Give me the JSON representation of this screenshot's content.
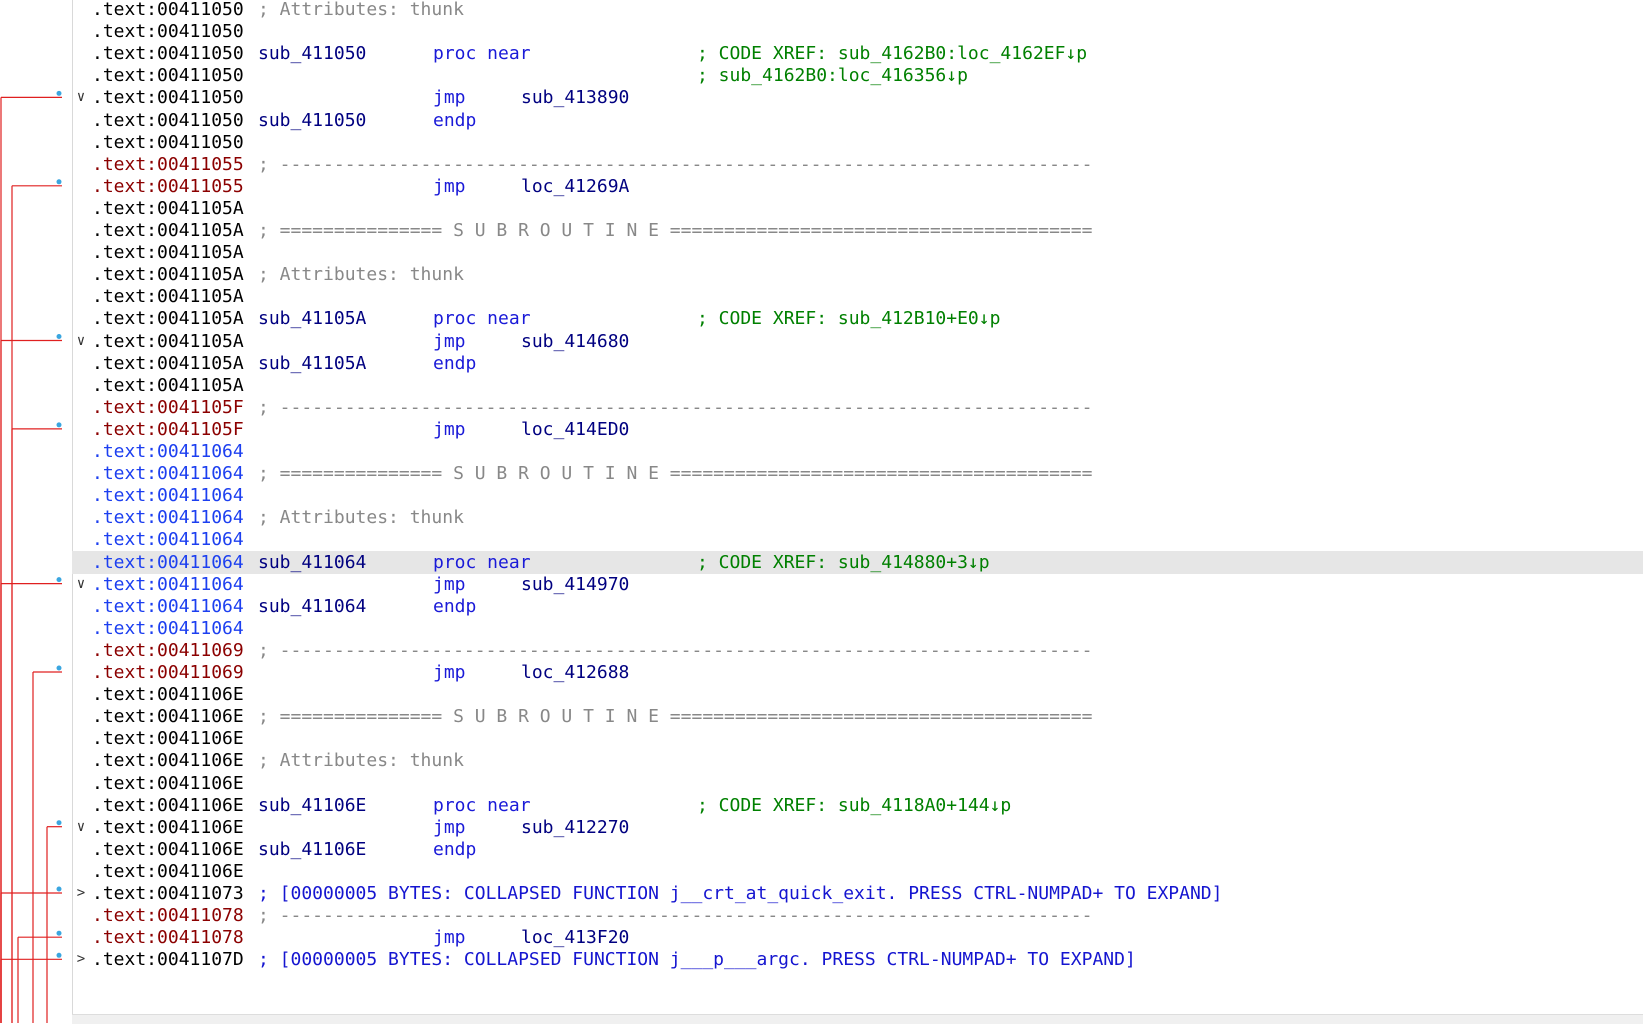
{
  "colors": {
    "addr_default": "#000000",
    "addr_unexplored": "#8b0000",
    "addr_current_func": "#1c3ff0",
    "xref_comment": "#008000",
    "comment": "#888888",
    "arrow": "#e02020",
    "highlight": "#e6e6e6"
  },
  "rows": [
    {
      "seg": ".text:00411050",
      "sc": "black",
      "cmt": "; Attributes: thunk",
      "ct": "c186"
    },
    {
      "seg": ".text:00411050",
      "sc": "black"
    },
    {
      "seg": ".text:00411050",
      "sc": "black",
      "label": "sub_411050",
      "mnem": "proc near",
      "cmt": "; CODE XREF: sub_4162B0:loc_4162EF↓p",
      "ct": "c625 grn"
    },
    {
      "seg": ".text:00411050",
      "sc": "black",
      "cmt": "; sub_4162B0:loc_416356↓p",
      "ct": "c625 grn"
    },
    {
      "seg": ".text:00411050",
      "sc": "black",
      "fold": "∨",
      "mnem": "jmp",
      "oper": "sub_413890"
    },
    {
      "seg": ".text:00411050",
      "sc": "black",
      "label": "sub_411050",
      "mnem": "endp"
    },
    {
      "seg": ".text:00411050",
      "sc": "black"
    },
    {
      "seg": ".text:00411055",
      "sc": "red",
      "cmt": "; ---------------------------------------------------------------------------",
      "ct": "c186"
    },
    {
      "seg": ".text:00411055",
      "sc": "red",
      "mnem": "jmp",
      "oper": "loc_41269A"
    },
    {
      "seg": ".text:0041105A",
      "sc": "black"
    },
    {
      "seg": ".text:0041105A",
      "sc": "black",
      "cmt": "; =============== S U B R O U T I N E =======================================",
      "ct": "c186"
    },
    {
      "seg": ".text:0041105A",
      "sc": "black"
    },
    {
      "seg": ".text:0041105A",
      "sc": "black",
      "cmt": "; Attributes: thunk",
      "ct": "c186"
    },
    {
      "seg": ".text:0041105A",
      "sc": "black"
    },
    {
      "seg": ".text:0041105A",
      "sc": "black",
      "label": "sub_41105A",
      "mnem": "proc near",
      "cmt": "; CODE XREF: sub_412B10+E0↓p",
      "ct": "c625 grn"
    },
    {
      "seg": ".text:0041105A",
      "sc": "black",
      "fold": "∨",
      "mnem": "jmp",
      "oper": "sub_414680"
    },
    {
      "seg": ".text:0041105A",
      "sc": "black",
      "label": "sub_41105A",
      "mnem": "endp"
    },
    {
      "seg": ".text:0041105A",
      "sc": "black"
    },
    {
      "seg": ".text:0041105F",
      "sc": "red",
      "cmt": "; ---------------------------------------------------------------------------",
      "ct": "c186"
    },
    {
      "seg": ".text:0041105F",
      "sc": "red",
      "mnem": "jmp",
      "oper": "loc_414ED0"
    },
    {
      "seg": ".text:00411064",
      "sc": "blue"
    },
    {
      "seg": ".text:00411064",
      "sc": "blue",
      "cmt": "; =============== S U B R O U T I N E =======================================",
      "ct": "c186"
    },
    {
      "seg": ".text:00411064",
      "sc": "blue"
    },
    {
      "seg": ".text:00411064",
      "sc": "blue",
      "cmt": "; Attributes: thunk",
      "ct": "c186"
    },
    {
      "seg": ".text:00411064",
      "sc": "blue"
    },
    {
      "seg": ".text:00411064",
      "sc": "blue",
      "hl": true,
      "label": "sub_411064",
      "mnem": "proc near",
      "cmt": "; CODE XREF: sub_414880+3↓p",
      "ct": "c625 grn"
    },
    {
      "seg": ".text:00411064",
      "sc": "blue",
      "fold": "∨",
      "mnem": "jmp",
      "oper": "sub_414970"
    },
    {
      "seg": ".text:00411064",
      "sc": "blue",
      "label": "sub_411064",
      "mnem": "endp"
    },
    {
      "seg": ".text:00411064",
      "sc": "blue"
    },
    {
      "seg": ".text:00411069",
      "sc": "red",
      "cmt": "; ---------------------------------------------------------------------------",
      "ct": "c186"
    },
    {
      "seg": ".text:00411069",
      "sc": "red",
      "mnem": "jmp",
      "oper": "loc_412688"
    },
    {
      "seg": ".text:0041106E",
      "sc": "black"
    },
    {
      "seg": ".text:0041106E",
      "sc": "black",
      "cmt": "; =============== S U B R O U T I N E =======================================",
      "ct": "c186"
    },
    {
      "seg": ".text:0041106E",
      "sc": "black"
    },
    {
      "seg": ".text:0041106E",
      "sc": "black",
      "cmt": "; Attributes: thunk",
      "ct": "c186"
    },
    {
      "seg": ".text:0041106E",
      "sc": "black"
    },
    {
      "seg": ".text:0041106E",
      "sc": "black",
      "label": "sub_41106E",
      "mnem": "proc near",
      "cmt": "; CODE XREF: sub_4118A0+144↓p",
      "ct": "c625 grn"
    },
    {
      "seg": ".text:0041106E",
      "sc": "black",
      "fold": "∨",
      "mnem": "jmp",
      "oper": "sub_412270"
    },
    {
      "seg": ".text:0041106E",
      "sc": "black",
      "label": "sub_41106E",
      "mnem": "endp"
    },
    {
      "seg": ".text:0041106E",
      "sc": "black"
    },
    {
      "seg": ".text:00411073",
      "sc": "black",
      "fold": ">",
      "cmt": "; [00000005 BYTES: COLLAPSED FUNCTION j__crt_at_quick_exit. PRESS CTRL-NUMPAD+ TO EXPAND]",
      "ct": "c186 blu"
    },
    {
      "seg": ".text:00411078",
      "sc": "red",
      "cmt": "; ---------------------------------------------------------------------------",
      "ct": "c186"
    },
    {
      "seg": ".text:00411078",
      "sc": "red",
      "mnem": "jmp",
      "oper": "loc_413F20"
    },
    {
      "seg": ".text:0041107D",
      "sc": "black",
      "fold": ">",
      "cmt": "; [00000005 BYTES: COLLAPSED FUNCTION j___p___argc. PRESS CTRL-NUMPAD+ TO EXPAND]",
      "ct": "c186 blu"
    }
  ]
}
